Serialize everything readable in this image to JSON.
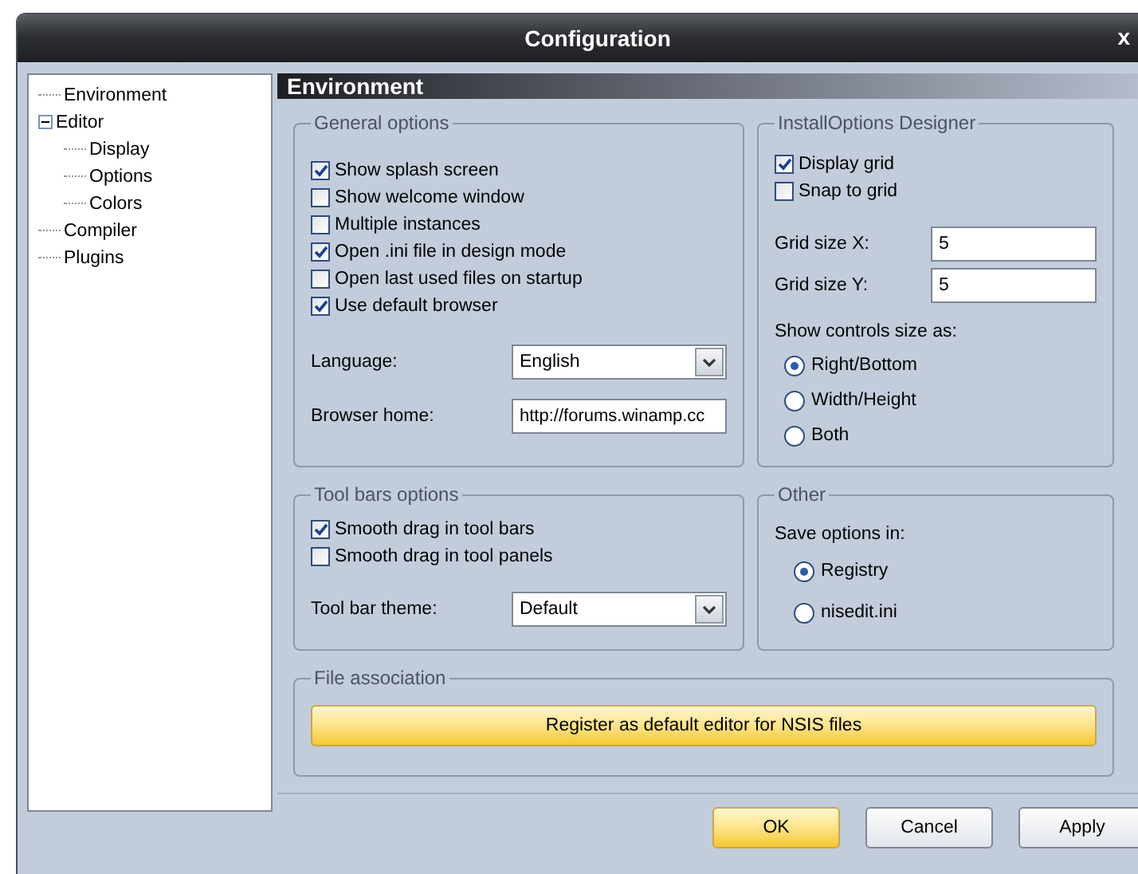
{
  "window": {
    "title": "Configuration",
    "close": "x"
  },
  "tree": [
    {
      "label": "Environment"
    },
    {
      "label": "Editor",
      "expanded": true,
      "children": [
        {
          "label": "Display"
        },
        {
          "label": "Options"
        },
        {
          "label": "Colors"
        }
      ]
    },
    {
      "label": "Compiler"
    },
    {
      "label": "Plugins"
    }
  ],
  "page_title": "Environment",
  "general_options": {
    "title": "General options",
    "checkboxes": [
      {
        "label": "Show splash screen",
        "checked": true
      },
      {
        "label": "Show welcome window",
        "checked": false
      },
      {
        "label": "Multiple instances",
        "checked": false
      },
      {
        "label": "Open .ini file in design mode",
        "checked": true
      },
      {
        "label": "Open last used files on startup",
        "checked": false
      },
      {
        "label": "Use default browser",
        "checked": true
      }
    ],
    "language": {
      "label": "Language:",
      "value": "English"
    },
    "browser_home": {
      "label": "Browser home:",
      "value": "http://forums.winamp.cc"
    }
  },
  "designer": {
    "title": "InstallOptions Designer",
    "checkboxes": [
      {
        "label": "Display grid",
        "checked": true
      },
      {
        "label": "Snap to grid",
        "checked": false
      }
    ],
    "grid_x": {
      "label": "Grid size X:",
      "value": "5"
    },
    "grid_y": {
      "label": "Grid size Y:",
      "value": "5"
    },
    "show_as": {
      "label": "Show controls size as:",
      "options": [
        {
          "label": "Right/Bottom",
          "selected": true
        },
        {
          "label": "Width/Height",
          "selected": false
        },
        {
          "label": "Both",
          "selected": false
        }
      ]
    }
  },
  "toolbars": {
    "title": "Tool bars options",
    "checkboxes": [
      {
        "label": "Smooth drag in tool bars",
        "checked": true
      },
      {
        "label": "Smooth drag in tool panels",
        "checked": false
      }
    ],
    "theme": {
      "label": "Tool bar theme:",
      "value": "Default"
    }
  },
  "other": {
    "title": "Other",
    "label": "Save options in:",
    "options": [
      {
        "label": "Registry",
        "selected": true
      },
      {
        "label": "nisedit.ini",
        "selected": false
      }
    ]
  },
  "file_association": {
    "title": "File association",
    "button": "Register as default editor for NSIS files"
  },
  "buttons": [
    {
      "label": "OK",
      "default": true
    },
    {
      "label": "Cancel",
      "default": false
    },
    {
      "label": "Apply",
      "default": false
    }
  ]
}
